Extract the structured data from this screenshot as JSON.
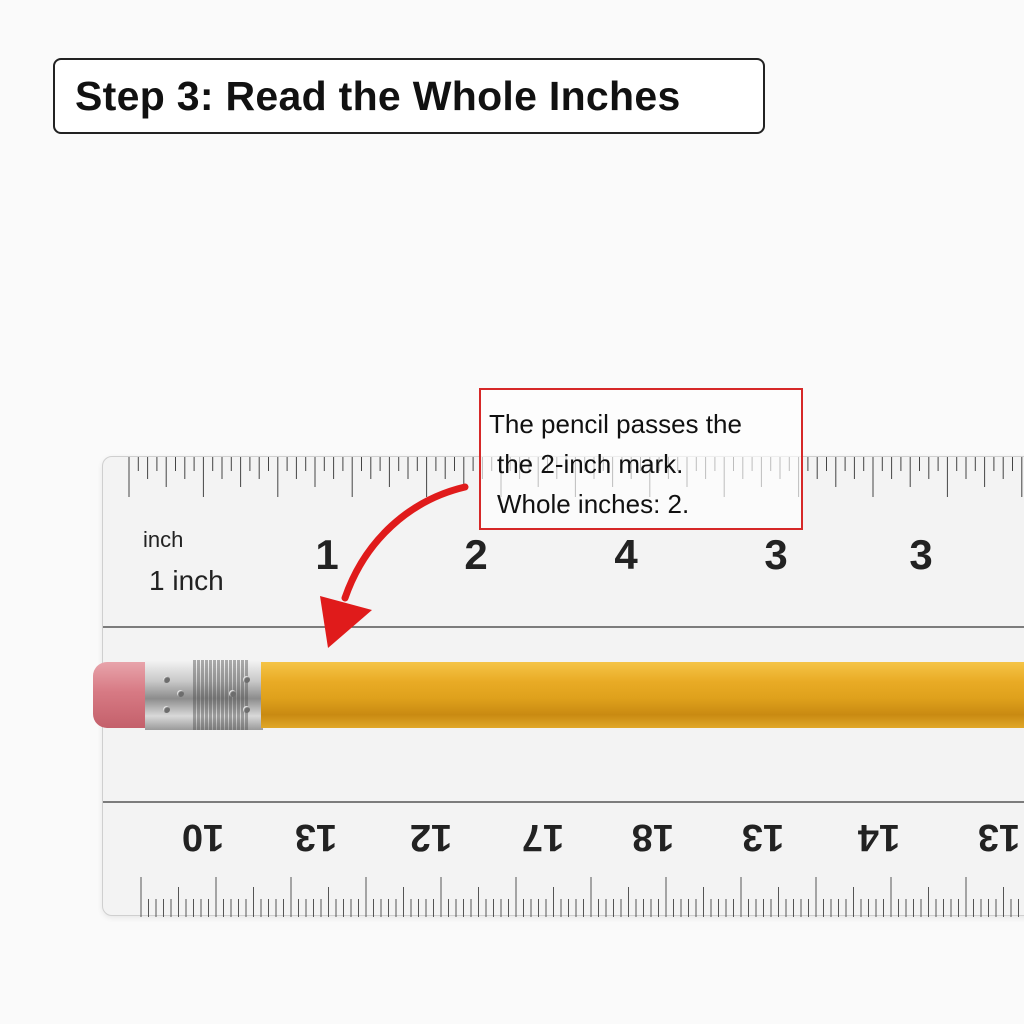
{
  "title": "Step 3: Read the Whole Inches",
  "callout": {
    "line1": "The pencil passes the",
    "line2": "the 2-inch mark.",
    "line3": "Whole inches: 2."
  },
  "ruler": {
    "top_unit_small": "inch",
    "top_unit_label": "1 inch",
    "top_numbers": [
      "1",
      "2",
      "4",
      "3",
      "3"
    ],
    "bottom_numbers": [
      "10",
      "13",
      "12",
      "17",
      "18",
      "13",
      "14",
      "13"
    ]
  },
  "colors": {
    "callout_border": "#d62828",
    "arrow": "#e01b1b",
    "pencil_barrel": "#e9ab25",
    "eraser": "#d77a84"
  },
  "icons": [
    "curved-arrow-icon"
  ]
}
